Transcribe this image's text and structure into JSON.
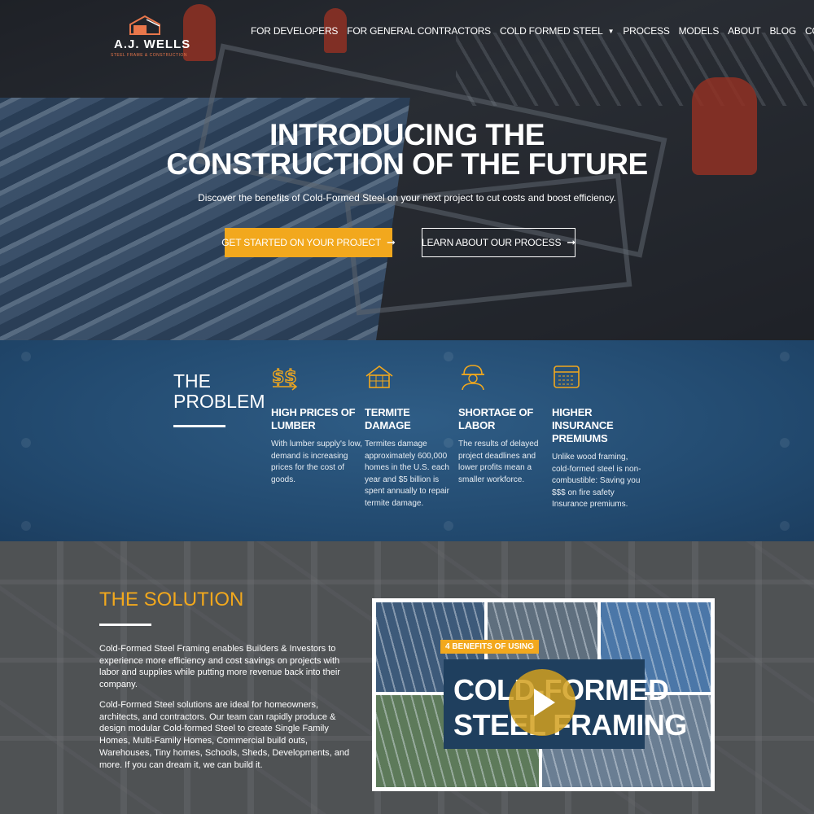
{
  "brand": {
    "name": "A.J. WELLS",
    "tagline": "STEEL FRAME & CONSTRUCTION",
    "colors": {
      "accent": "#f2a81d",
      "problem_bg": "#21486d",
      "logo": "#e9774b"
    }
  },
  "nav": {
    "items": [
      {
        "label": "FOR DEVELOPERS"
      },
      {
        "label": "FOR GENERAL CONTRACTORS"
      },
      {
        "label": "COLD FORMED STEEL",
        "dropdown": true
      },
      {
        "label": "PROCESS"
      },
      {
        "label": "MODELS"
      },
      {
        "label": "ABOUT"
      },
      {
        "label": "BLOG"
      },
      {
        "label": "CONTACT"
      }
    ],
    "dropdown_icon": "chevron-down-icon"
  },
  "hero": {
    "title_line1": "INTRODUCING THE",
    "title_line2": "CONSTRUCTION OF THE FUTURE",
    "subtitle": "Discover the benefits of Cold-Formed Steel on your next project to cut costs and boost efficiency.",
    "cta_primary": "GET STARTED ON YOUR PROJECT",
    "cta_secondary": "LEARN ABOUT OUR PROCESS",
    "arrow_icon": "arrow-right-icon"
  },
  "problem": {
    "title_line1": "THE",
    "title_line2": "PROBLEM",
    "items": [
      {
        "icon": "dollar-signs-icon",
        "heading": "HIGH PRICES OF LUMBER",
        "text": "With lumber supply's low, demand is increasing prices for the cost of goods."
      },
      {
        "icon": "house-icon",
        "heading": "TERMITE DAMAGE",
        "text": "Termites damage approximately 600,000 homes in the U.S. each year and $5 billion is spent annually to repair termite damage."
      },
      {
        "icon": "worker-icon",
        "heading": "SHORTAGE OF LABOR",
        "text": "The results of delayed project deadlines and lower profits mean a smaller workforce."
      },
      {
        "icon": "calculator-icon",
        "heading": "HIGHER INSURANCE PREMIUMS",
        "text": "Unlike wood framing, cold-formed steel is non-combustible: Saving you $$$ on fire safety Insurance premiums."
      }
    ]
  },
  "solution": {
    "title": "THE SOLUTION",
    "paragraph1": "Cold-Formed Steel Framing enables Builders & Investors to experience more efficiency and cost savings on projects with labor and supplies while putting more revenue back into their company.",
    "paragraph2": "Cold-Formed Steel solutions are ideal for homeowners, architects, and contractors. Our team can rapidly produce & design modular Cold-formed Steel to create Single Family Homes, Multi-Family Homes, Commercial build outs, Warehouses, Tiny homes, Schools, Sheds, Developments, and more. If you can dream it, we can build it.",
    "video": {
      "tag": "4 BENEFITS OF USING",
      "title_line1": "COLD-FORMED",
      "title_line2": "STEEL FRAMING",
      "play_icon": "play-icon"
    }
  }
}
